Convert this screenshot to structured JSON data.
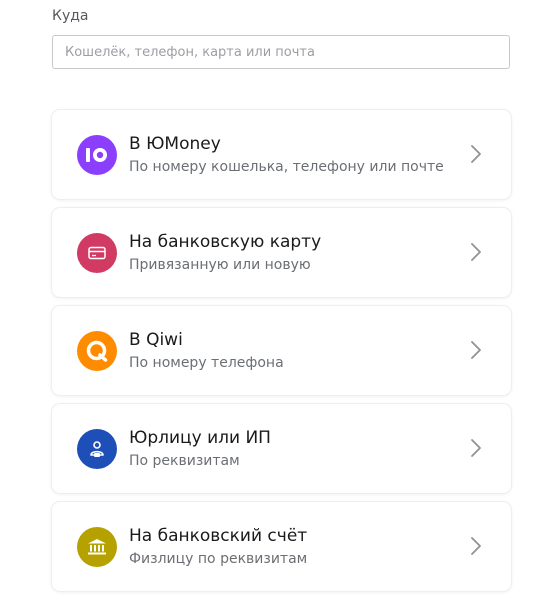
{
  "destination": {
    "label": "Куда",
    "placeholder": "Кошелёк, телефон, карта или почта"
  },
  "options": [
    {
      "title": "В ЮMoney",
      "subtitle": "По номеру кошелька, телефону или почте",
      "icon": "yoomoney-icon",
      "color": "#8b3ffd"
    },
    {
      "title": "На банковскую карту",
      "subtitle": "Привязанную или новую",
      "icon": "bank-card-icon",
      "color": "#d13a63"
    },
    {
      "title": "В Qiwi",
      "subtitle": "По номеру телефона",
      "icon": "qiwi-icon",
      "color": "#ff8c00"
    },
    {
      "title": "Юрлицу или ИП",
      "subtitle": "По реквизитам",
      "icon": "legal-entity-icon",
      "color": "#1e4fb8"
    },
    {
      "title": "На банковский счёт",
      "subtitle": "Физлицу по реквизитам",
      "icon": "bank-building-icon",
      "color": "#b5a200"
    }
  ]
}
